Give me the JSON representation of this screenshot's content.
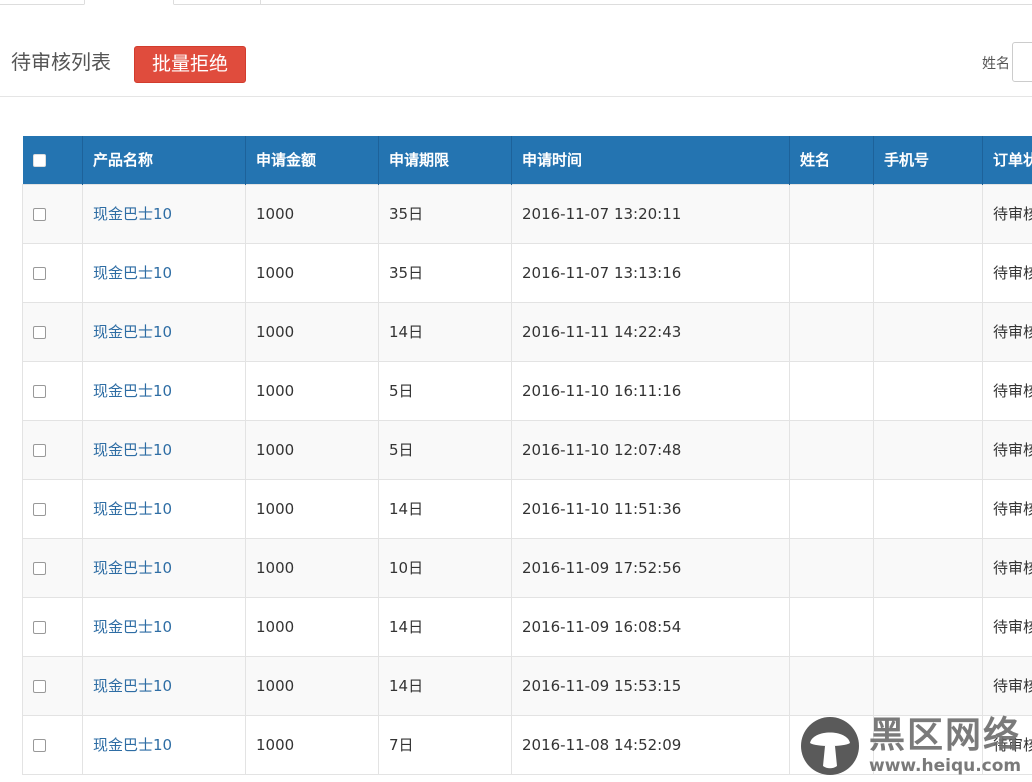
{
  "header": {
    "title": "待审核列表",
    "reject_button": "批量拒绝",
    "search_label": "姓名",
    "search_value": ""
  },
  "table": {
    "columns": [
      "产品名称",
      "申请金额",
      "申请期限",
      "申请时间",
      "姓名",
      "手机号",
      "订单状态"
    ],
    "rows": [
      {
        "product": "现金巴士10",
        "amount": "1000",
        "term": "35日",
        "time": "2016-11-07 13:20:11",
        "name": "",
        "phone": "",
        "status": "待审核"
      },
      {
        "product": "现金巴士10",
        "amount": "1000",
        "term": "35日",
        "time": "2016-11-07 13:13:16",
        "name": "",
        "phone": "",
        "status": "待审核"
      },
      {
        "product": "现金巴士10",
        "amount": "1000",
        "term": "14日",
        "time": "2016-11-11 14:22:43",
        "name": "",
        "phone": "",
        "status": "待审核"
      },
      {
        "product": "现金巴士10",
        "amount": "1000",
        "term": "5日",
        "time": "2016-11-10 16:11:16",
        "name": "",
        "phone": "",
        "status": "待审核"
      },
      {
        "product": "现金巴士10",
        "amount": "1000",
        "term": "5日",
        "time": "2016-11-10 12:07:48",
        "name": "",
        "phone": "",
        "status": "待审核"
      },
      {
        "product": "现金巴士10",
        "amount": "1000",
        "term": "14日",
        "time": "2016-11-10 11:51:36",
        "name": "",
        "phone": "",
        "status": "待审核"
      },
      {
        "product": "现金巴士10",
        "amount": "1000",
        "term": "10日",
        "time": "2016-11-09 17:52:56",
        "name": "",
        "phone": "",
        "status": "待审核"
      },
      {
        "product": "现金巴士10",
        "amount": "1000",
        "term": "14日",
        "time": "2016-11-09 16:08:54",
        "name": "",
        "phone": "",
        "status": "待审核"
      },
      {
        "product": "现金巴士10",
        "amount": "1000",
        "term": "14日",
        "time": "2016-11-09 15:53:15",
        "name": "",
        "phone": "",
        "status": "待审核"
      },
      {
        "product": "现金巴士10",
        "amount": "1000",
        "term": "7日",
        "time": "2016-11-08 14:52:09",
        "name": "",
        "phone": "",
        "status": "待审核"
      }
    ]
  },
  "watermark": {
    "name": "黑区网络",
    "url": "www.heiqu.com"
  },
  "colors": {
    "header_bg": "#2474b1",
    "danger": "#e04c3d",
    "link": "#2e6da4"
  }
}
